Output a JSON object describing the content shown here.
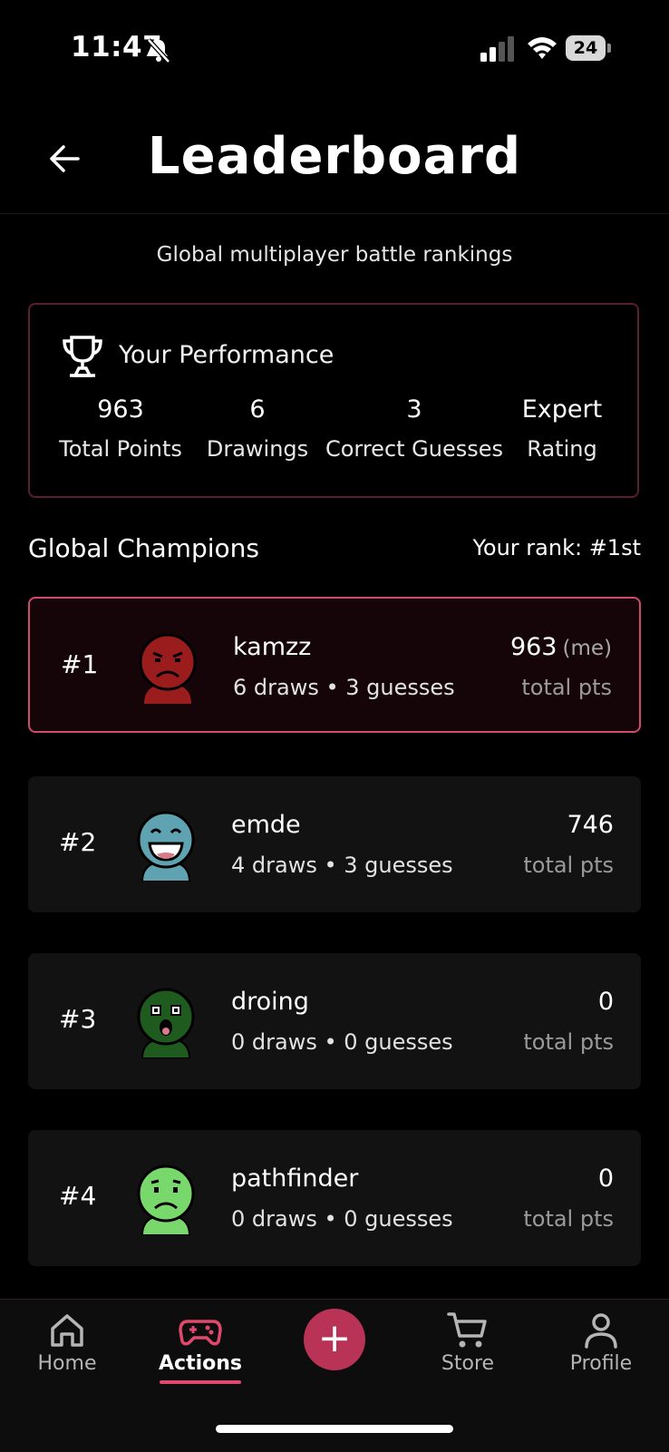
{
  "status_bar": {
    "time": "11:47",
    "battery": "24"
  },
  "header": {
    "title": "Leaderboard"
  },
  "subtitle": "Global multiplayer battle rankings",
  "performance": {
    "title": "Your Performance",
    "stats": [
      {
        "value": "963",
        "label": "Total Points"
      },
      {
        "value": "6",
        "label": "Drawings"
      },
      {
        "value": "3",
        "label": "Correct Guesses"
      },
      {
        "value": "Expert",
        "label": "Rating"
      }
    ]
  },
  "section": {
    "title": "Global Champions",
    "rank": "Your rank: #1st"
  },
  "rows": [
    {
      "rank": "#1",
      "name": "kamzz",
      "meta": "6 draws • 3 guesses",
      "points": "963",
      "me": "(me)",
      "points_label": "total pts",
      "avatar_color": "#9b1c1c",
      "mood": "angry"
    },
    {
      "rank": "#2",
      "name": "emde",
      "meta": "4 draws • 3 guesses",
      "points": "746",
      "points_label": "total pts",
      "avatar_color": "#5fa3b2",
      "mood": "laugh"
    },
    {
      "rank": "#3",
      "name": "droing",
      "meta": "0 draws • 0 guesses",
      "points": "0",
      "points_label": "total pts",
      "avatar_color": "#1f5a1f",
      "mood": "shock"
    },
    {
      "rank": "#4",
      "name": "pathfinder",
      "meta": "0 draws • 0 guesses",
      "points": "0",
      "points_label": "total pts",
      "avatar_color": "#79d86b",
      "mood": "sad"
    }
  ],
  "tabbar": {
    "home": "Home",
    "actions": "Actions",
    "add": "+",
    "store": "Store",
    "profile": "Profile"
  },
  "colors": {
    "accent": "#e0486d",
    "fab": "#b83355",
    "card_border": "#5a1f2e"
  }
}
